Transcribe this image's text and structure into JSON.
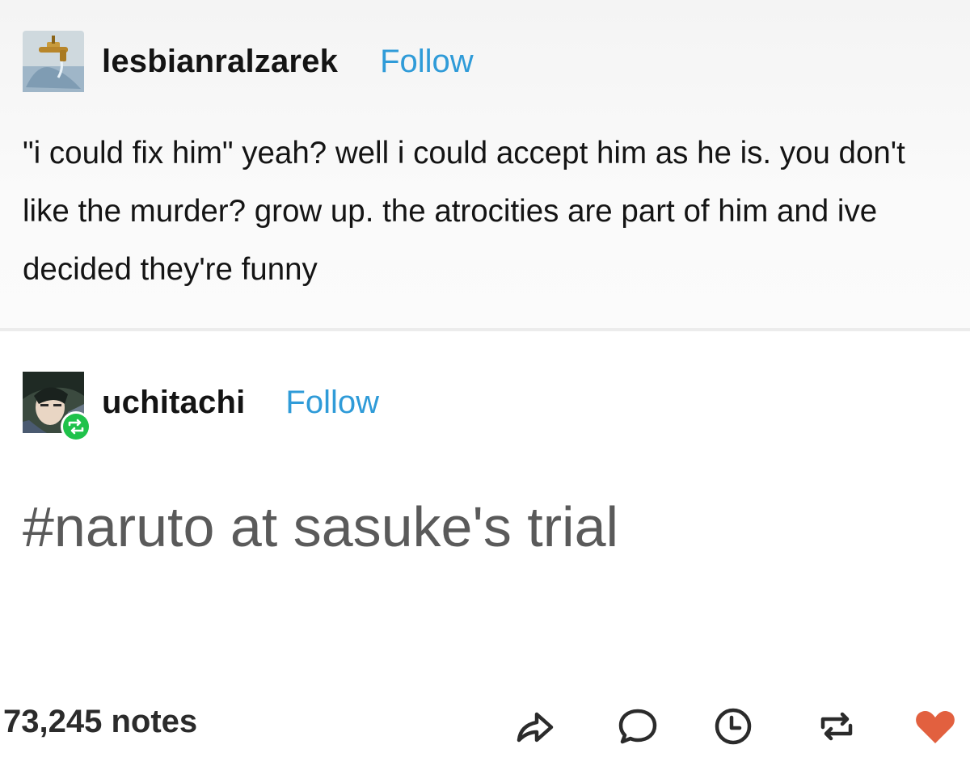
{
  "posts": [
    {
      "username": "lesbianralzarek",
      "follow_label": "Follow",
      "text": "\"i could fix him\" yeah? well i could accept him as he is. you don't like the murder? grow up. the atrocities are part of him and ive decided they're funny"
    },
    {
      "username": "uchitachi",
      "follow_label": "Follow",
      "tag": "#naruto at sasuke's trial"
    }
  ],
  "footer": {
    "notes": "73,245 notes",
    "actions": [
      "share-icon",
      "comment-icon",
      "history-icon",
      "reblog-icon",
      "heart-icon"
    ]
  },
  "colors": {
    "follow": "#2f9bd8",
    "like": "#e2603f",
    "reblog_badge": "#1fc24a",
    "tag_text": "#5a5a5a"
  }
}
